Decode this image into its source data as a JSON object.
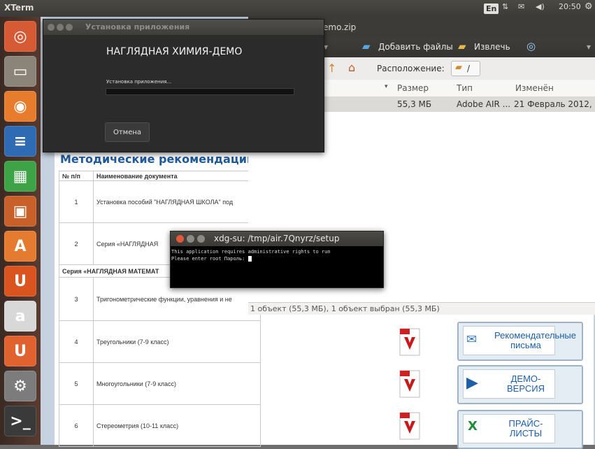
{
  "top_panel": {
    "app_title": "XTerm",
    "lang": "En",
    "time": "20:50"
  },
  "launcher": {
    "items": [
      {
        "name": "dash",
        "glyph": "◎",
        "color": "#d65a33"
      },
      {
        "name": "files",
        "glyph": "▭",
        "color": "#8a8479"
      },
      {
        "name": "firefox",
        "glyph": "◉",
        "color": "#e77d2c"
      },
      {
        "name": "writer",
        "glyph": "≡",
        "color": "#2f6bb3"
      },
      {
        "name": "calc",
        "glyph": "▦",
        "color": "#3ea246"
      },
      {
        "name": "impress",
        "glyph": "▣",
        "color": "#c8602a"
      },
      {
        "name": "software-center",
        "glyph": "A",
        "color": "#e57b2e"
      },
      {
        "name": "ubuntu-one",
        "glyph": "U",
        "color": "#d9541e"
      },
      {
        "name": "amazon",
        "glyph": "a",
        "color": "#d8d8d8"
      },
      {
        "name": "ubuntu-one-music",
        "glyph": "U",
        "color": "#e0622f"
      },
      {
        "name": "system-settings",
        "glyph": "⚙",
        "color": "#7c7c7c"
      },
      {
        "name": "terminal",
        "glyph": ">_",
        "color": "#3a3a3a"
      }
    ]
  },
  "archive": {
    "title_suffix": "emo.zip",
    "toolbar": {
      "add_files": "Добавить файлы",
      "extract": "Извлечь"
    },
    "location_label": "Расположение:",
    "location_value": "/",
    "columns": {
      "size": "Размер",
      "type": "Тип",
      "modified": "Изменён"
    },
    "row": {
      "size": "55,3 МБ",
      "type": "Adobe AIR ...",
      "modified": "21 Февраль 2012, ..."
    },
    "status": "1 объект (55,3 МБ), 1 объект выбран (55,3 МБ)"
  },
  "webpage": {
    "section_title": "Методические рекомендации",
    "table": {
      "headers": [
        "№ п/п",
        "Наименование документа"
      ],
      "rows": [
        {
          "num": "1",
          "name": "Установка пособий \"НАГЛЯДНАЯ ШКОЛА\" под"
        },
        {
          "num": "2",
          "name": "Серия «НАГЛЯДНАЯ"
        },
        {
          "num": "",
          "name": "Серия «НАГЛЯДНАЯ МАТЕМАТ"
        },
        {
          "num": "3",
          "name": "Тригонометрические функции, уравнения и не"
        },
        {
          "num": "4",
          "name": "Треугольники (7-9 класс)"
        },
        {
          "num": "5",
          "name": "Многоугольники (7-9 класс)"
        },
        {
          "num": "6",
          "name": "Стереометрия (10-11 класс)"
        }
      ]
    },
    "side_buttons": [
      {
        "label": "Рекомендательные письма"
      },
      {
        "label": "ДЕМО-ВЕРСИЯ"
      },
      {
        "label": "ПРАЙС-ЛИСТЫ"
      }
    ]
  },
  "installer": {
    "window_title": "Установка приложения",
    "app_name": "НАГЛЯДНАЯ ХИМИЯ-ДЕМО",
    "status": "Установка приложения...",
    "progress": 0.0,
    "cancel": "Отмена"
  },
  "terminal": {
    "title": "xdg-su: /tmp/air.7Qnyrz/setup",
    "line1": "This application requires administrative rights to run",
    "line2": "Please enter root Пароль: "
  }
}
